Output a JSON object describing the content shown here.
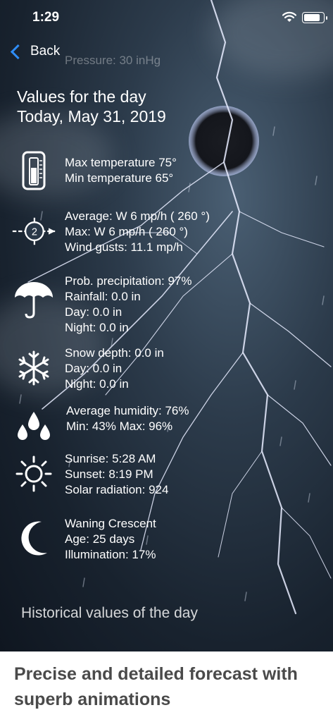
{
  "status_bar": {
    "time": "1:29",
    "wifi_icon": "wifi-icon",
    "battery_icon": "battery-icon"
  },
  "nav": {
    "back_label": "Back"
  },
  "background_text": {
    "pressure": "Pressure: 30 inHg"
  },
  "header": {
    "line1": "Values for the day",
    "line2": "Today, May 31, 2019"
  },
  "sections": {
    "temperature": {
      "icon": "thermometer-icon",
      "max": "Max temperature 75°",
      "min": "Min temperature 65°"
    },
    "wind": {
      "icon": "wind-direction-icon",
      "badge": "2",
      "average": "Average: W 6 mp/h ( 260 °)",
      "max": "Max: W 6 mp/h ( 260 °)",
      "gusts": "Wind gusts: 11.1 mp/h"
    },
    "precipitation": {
      "icon": "umbrella-icon",
      "prob": "Prob. precipitation: 97%",
      "rainfall": "Rainfall: 0.0 in",
      "day": "Day: 0.0 in",
      "night": "Night: 0.0 in"
    },
    "snow": {
      "icon": "snowflake-icon",
      "depth": "Snow depth: 0.0 in",
      "day": "Day: 0.0 in",
      "night": "Night: 0.0 in"
    },
    "humidity": {
      "icon": "humidity-drops-icon",
      "average": "Average humidity: 76%",
      "minmax": "Min: 43%  Max: 96%"
    },
    "sun": {
      "icon": "sun-icon",
      "sunrise": "Sunrise: 5:28 AM",
      "sunset": "Sunset: 8:19 PM",
      "radiation": "Solar radiation: 924"
    },
    "moon": {
      "icon": "moon-icon",
      "phase": "Waning Crescent",
      "age": "Age: 25 days",
      "illumination": "Illumination: 17%"
    }
  },
  "historical_link": "Historical values of the day",
  "footer": {
    "caption": "Precise and detailed forecast with superb animations"
  }
}
